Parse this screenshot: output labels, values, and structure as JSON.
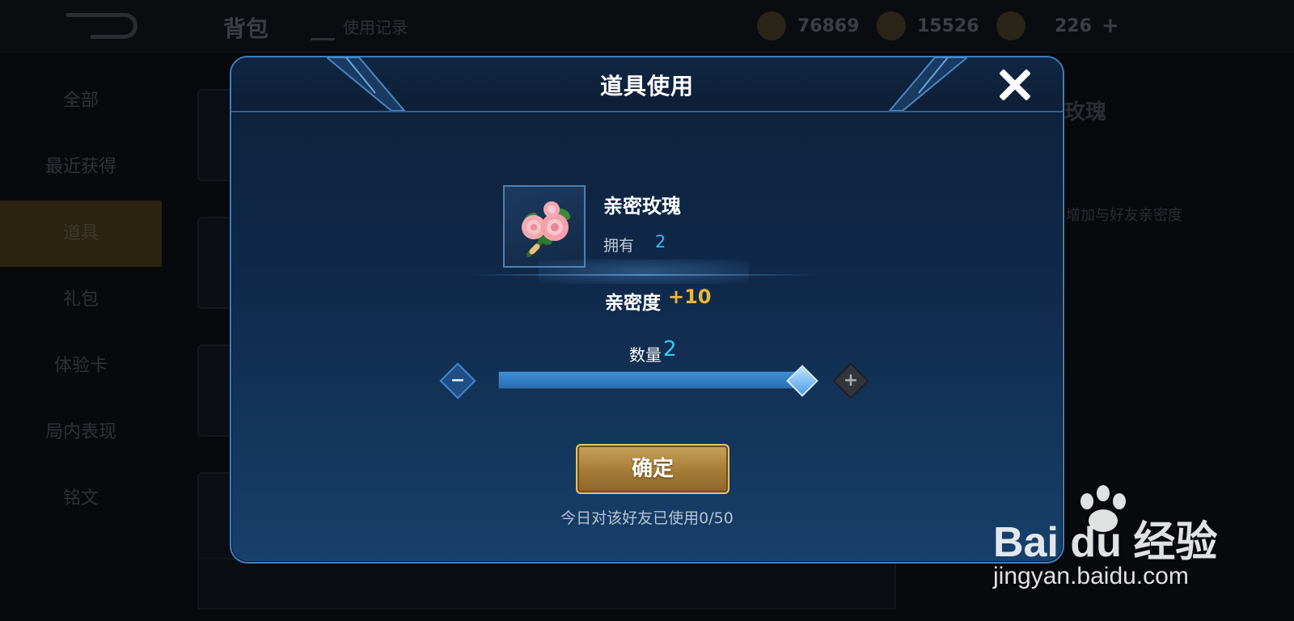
{
  "background": {
    "page_title": "背包",
    "sub_action": "使用记录",
    "resources": [
      {
        "icon": "gold-coin-icon",
        "value": "76869"
      },
      {
        "icon": "gem-icon",
        "value": "15526"
      },
      {
        "icon": "ticket-icon",
        "value": "226"
      }
    ],
    "sidebar": [
      {
        "label": "全部"
      },
      {
        "label": "最近获得"
      },
      {
        "label": "道具"
      },
      {
        "label": "礼包"
      },
      {
        "label": "体验卡"
      },
      {
        "label": "局内表现"
      },
      {
        "label": "铭文"
      }
    ],
    "right_title": "玫瑰",
    "right_desc": "增加与好友亲密度"
  },
  "modal": {
    "title": "道具使用",
    "item": {
      "icon": "rose-bouquet-icon",
      "name": "亲密玫瑰",
      "own_label": "拥有",
      "own_count": "2"
    },
    "intimacy_label": "亲密度",
    "intimacy_value": "+10",
    "quantity_label": "数量",
    "quantity_value": "2",
    "quantity_level": 1.0,
    "confirm_label": "确定",
    "usage_note": "今日对该好友已使用0/50"
  },
  "watermark": {
    "logo": "Bai du 经验",
    "url": "jingyan.baidu.com"
  },
  "colors": {
    "accent_blue": "#38b7ff",
    "gold": "#f0b43c",
    "modal_border": "#3f7fbf"
  }
}
